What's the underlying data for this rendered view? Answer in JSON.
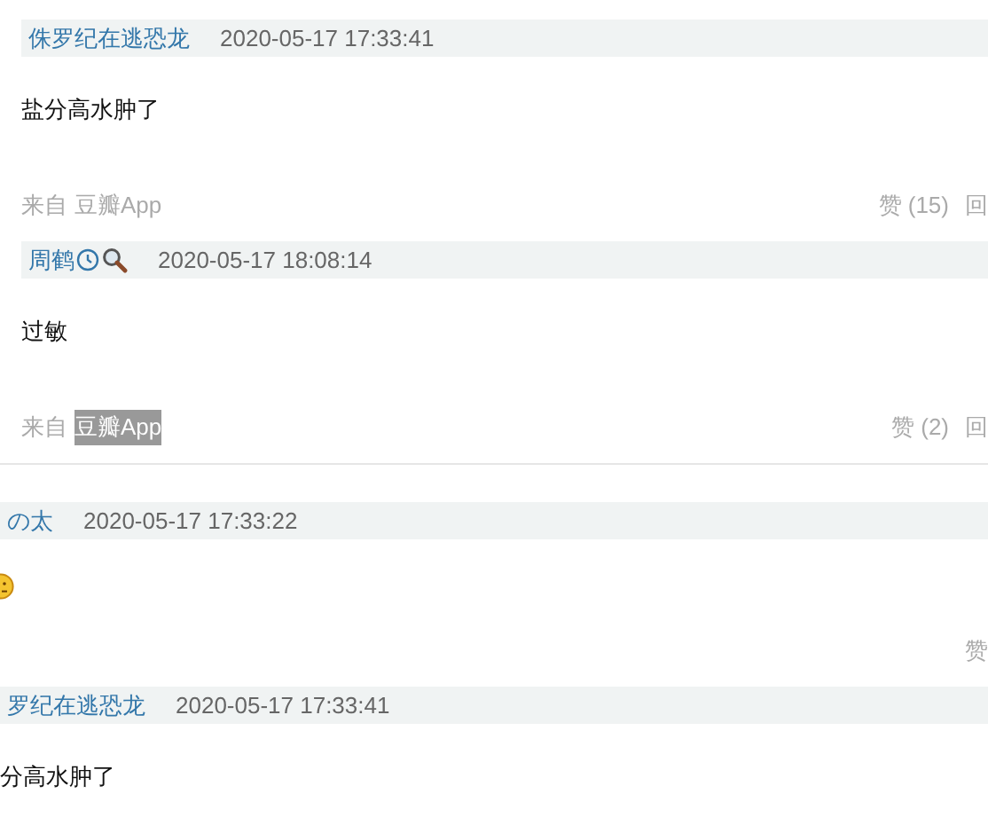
{
  "sections": [
    {
      "kind": "indented",
      "comments": [
        {
          "author": "侏罗纪在逃恐龙",
          "has_badges": false,
          "time": "2020-05-17 17:33:41",
          "body": {
            "kind": "text",
            "text": "盐分高水肿了"
          },
          "source": {
            "prefix": "来自",
            "app": "豆瓣App",
            "highlighted": false
          },
          "likes": "赞 (15)",
          "reply": "回"
        },
        {
          "author": "周鹤",
          "has_badges": true,
          "time": "2020-05-17 18:08:14",
          "body": {
            "kind": "text",
            "text": "过敏"
          },
          "source": {
            "prefix": "来自",
            "app": "豆瓣App",
            "highlighted": true
          },
          "likes": "赞 (2)",
          "reply": "回"
        }
      ]
    },
    {
      "kind": "flush",
      "comments": [
        {
          "author": "の太",
          "has_badges": false,
          "time": "2020-05-17 17:33:22",
          "body": {
            "kind": "emoji"
          },
          "likes": "赞"
        },
        {
          "author": "罗纪在逃恐龙",
          "has_badges": false,
          "time": "2020-05-17 17:33:41",
          "body": {
            "kind": "text",
            "text": "分高水肿了"
          }
        }
      ]
    }
  ]
}
